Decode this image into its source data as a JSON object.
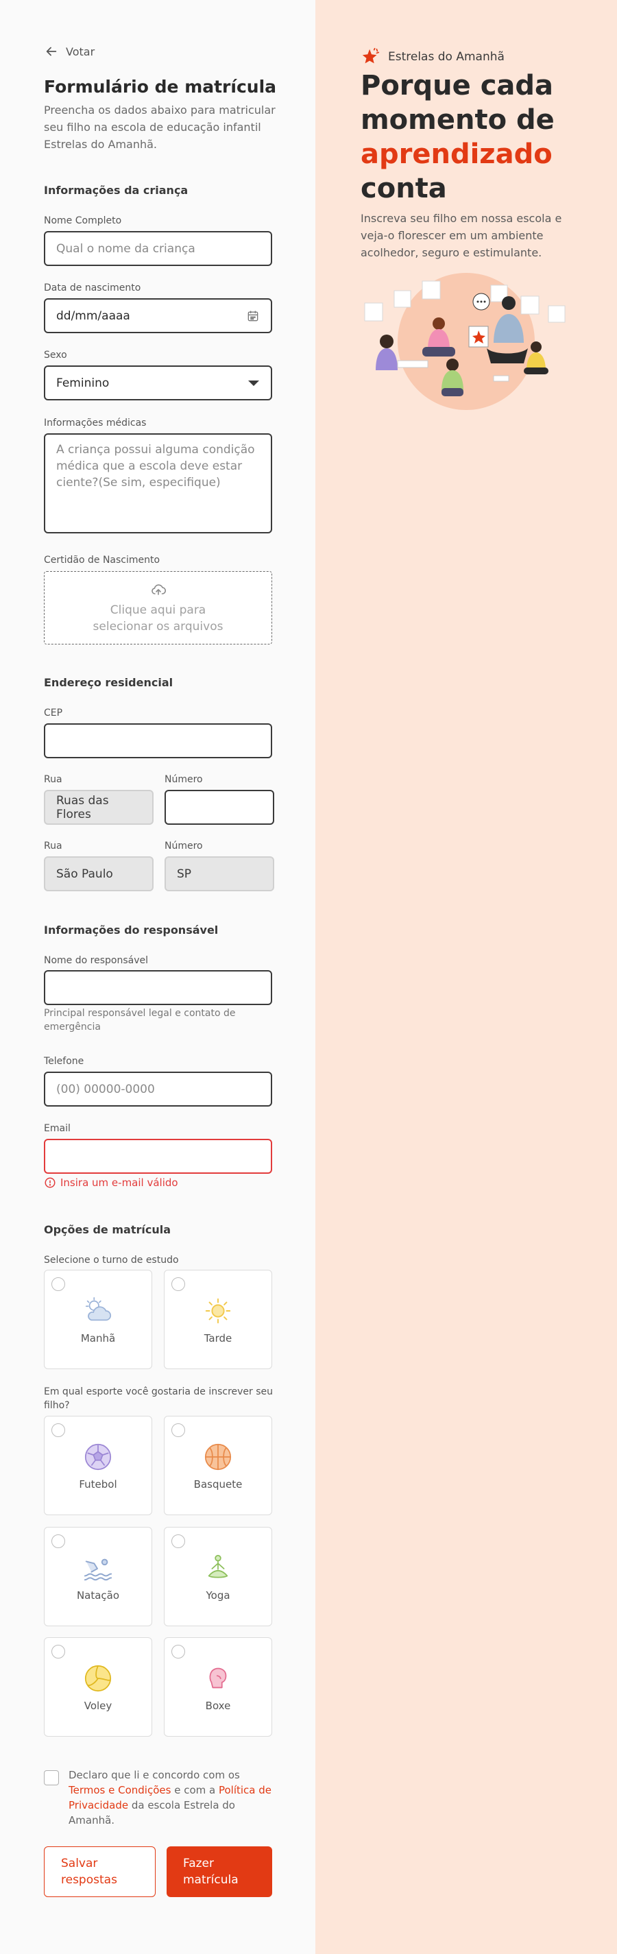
{
  "back": {
    "label": "Votar"
  },
  "form": {
    "title": "Formulário de matrícula",
    "intro": "Preencha os dados abaixo para matricular seu filho na escola de educação infantil Estrelas do Amanhã."
  },
  "child": {
    "section": "Informações da criança",
    "name_label": "Nome Completo",
    "name_placeholder": "Qual o nome da criança",
    "birth_label": "Data de nascimento",
    "birth_value": "dd/mm/aaaa",
    "sex_label": "Sexo",
    "sex_value": "Feminino",
    "medical_label": "Informações médicas",
    "medical_placeholder": "A criança possui alguma condição médica que a escola deve estar ciente?(Se sim, especifique)",
    "cert_label": "Certidão de Nascimento",
    "cert_upload": "Clique aqui para selecionar os arquivos"
  },
  "address": {
    "section": "Endereço residencial",
    "cep_label": "CEP",
    "cep_value": "",
    "street_label": "Rua",
    "street_value": "Ruas das Flores",
    "number_label": "Número",
    "number_value": "",
    "city_label": "Rua",
    "city_value": "São Paulo",
    "state_label": "Número",
    "state_value": "SP"
  },
  "guardian": {
    "section": "Informações do responsável",
    "name_label": "Nome do responsável",
    "name_value": "",
    "name_hint": "Principal responsável legal e contato de emergência",
    "phone_label": "Telefone",
    "phone_placeholder": "(00) 00000-0000",
    "email_label": "Email",
    "email_value": "",
    "email_error": "Insira um e-mail válido"
  },
  "enrollment": {
    "section": "Opções de matrícula",
    "shift_label": "Selecione o turno de estudo",
    "shifts": [
      {
        "label": "Manhã",
        "icon": "cloud-sun-icon"
      },
      {
        "label": "Tarde",
        "icon": "sun-icon"
      }
    ],
    "sport_label": "Em qual esporte você gostaria de inscrever seu filho?",
    "sports": [
      {
        "label": "Futebol",
        "icon": "soccer-ball-icon"
      },
      {
        "label": "Basquete",
        "icon": "basketball-icon"
      },
      {
        "label": "Natação",
        "icon": "swimmer-icon"
      },
      {
        "label": "Yoga",
        "icon": "yoga-icon"
      },
      {
        "label": "Voley",
        "icon": "volleyball-icon"
      },
      {
        "label": "Boxe",
        "icon": "boxing-glove-icon"
      }
    ]
  },
  "terms": {
    "prefix": "Declaro que li e concordo com os ",
    "terms_link": "Termos e Condições",
    "middle": " e com a ",
    "privacy_link": "Política de Privacidade",
    "suffix": " da escola Estrela do Amanhã."
  },
  "actions": {
    "save": "Salvar respostas",
    "submit": "Fazer matrícula"
  },
  "aside": {
    "brand": "Estrelas do Amanhã",
    "hero_line1": "Porque cada momento de",
    "hero_accent": "aprendizado",
    "hero_line2": "conta",
    "subtitle": "Inscreva seu filho em nossa escola e veja-o florescer em um ambiente acolhedor, seguro e estimulante."
  },
  "colors": {
    "accent": "#e23a14",
    "error": "#e23b3b",
    "aside_bg": "#fde6d9"
  }
}
